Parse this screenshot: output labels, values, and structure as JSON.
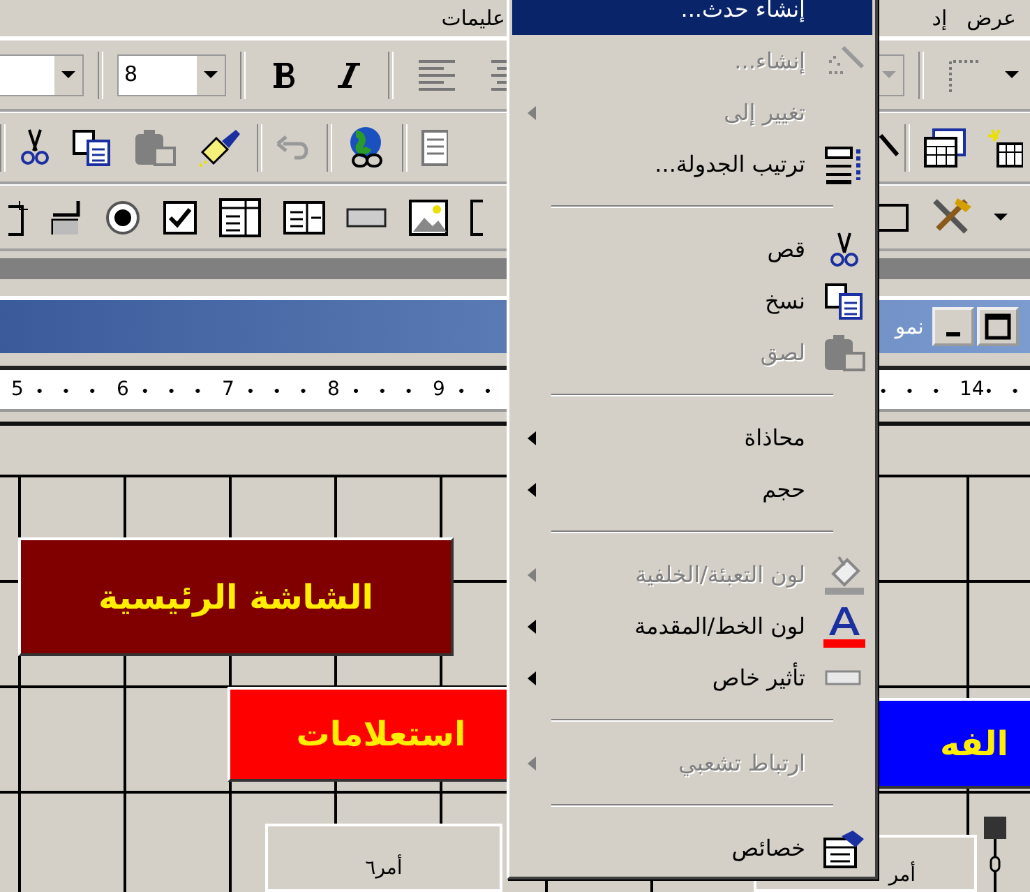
{
  "menu_bar": {
    "items": [
      {
        "label": "عرض"
      },
      {
        "label": "إد"
      },
      {
        "label": "عليمات"
      }
    ]
  },
  "formatting_toolbar": {
    "font_size": "8"
  },
  "form_window": {
    "title": "نمو"
  },
  "ruler": {
    "marks": [
      "14",
      "9",
      "8",
      "7",
      "6",
      "5"
    ]
  },
  "form_controls": [
    {
      "kind": "command",
      "label": "الشاشة الرئيسية",
      "color": "#800000"
    },
    {
      "kind": "command",
      "label": "استعلامات",
      "color": "#ff0000"
    },
    {
      "kind": "command",
      "label": "الفه",
      "color": "#0000ff"
    },
    {
      "kind": "plain",
      "label": "أمر٦"
    },
    {
      "kind": "plain",
      "label": "أمر"
    }
  ],
  "context_menu": {
    "items": [
      {
        "kind": "item",
        "label": "إنشاء حدث...",
        "selected": true,
        "disabled": false,
        "submenu": false
      },
      {
        "kind": "item",
        "label": "إنشاء...",
        "selected": false,
        "disabled": true,
        "submenu": false
      },
      {
        "kind": "item",
        "label": "تغيير إلى",
        "selected": false,
        "disabled": true,
        "submenu": true
      },
      {
        "kind": "item",
        "label": "ترتيب الجدولة...",
        "selected": false,
        "disabled": false,
        "submenu": false
      },
      {
        "kind": "separator"
      },
      {
        "kind": "item",
        "label": "قص",
        "selected": false,
        "disabled": false,
        "submenu": false
      },
      {
        "kind": "item",
        "label": "نسخ",
        "selected": false,
        "disabled": false,
        "submenu": false
      },
      {
        "kind": "item",
        "label": "لصق",
        "selected": false,
        "disabled": true,
        "submenu": false
      },
      {
        "kind": "separator"
      },
      {
        "kind": "item",
        "label": "محاذاة",
        "selected": false,
        "disabled": false,
        "submenu": true
      },
      {
        "kind": "item",
        "label": "حجم",
        "selected": false,
        "disabled": false,
        "submenu": true
      },
      {
        "kind": "separator"
      },
      {
        "kind": "item",
        "label": "لون التعبئة/الخلفية",
        "selected": false,
        "disabled": true,
        "submenu": true
      },
      {
        "kind": "item",
        "label": "لون الخط/المقدمة",
        "selected": false,
        "disabled": false,
        "submenu": true
      },
      {
        "kind": "item",
        "label": "تأثير خاص",
        "selected": false,
        "disabled": false,
        "submenu": true
      },
      {
        "kind": "separator"
      },
      {
        "kind": "item",
        "label": "ارتباط تشعبي",
        "selected": false,
        "disabled": true,
        "submenu": true
      },
      {
        "kind": "separator"
      },
      {
        "kind": "item",
        "label": "خصائص",
        "selected": false,
        "disabled": false,
        "submenu": false
      }
    ]
  }
}
